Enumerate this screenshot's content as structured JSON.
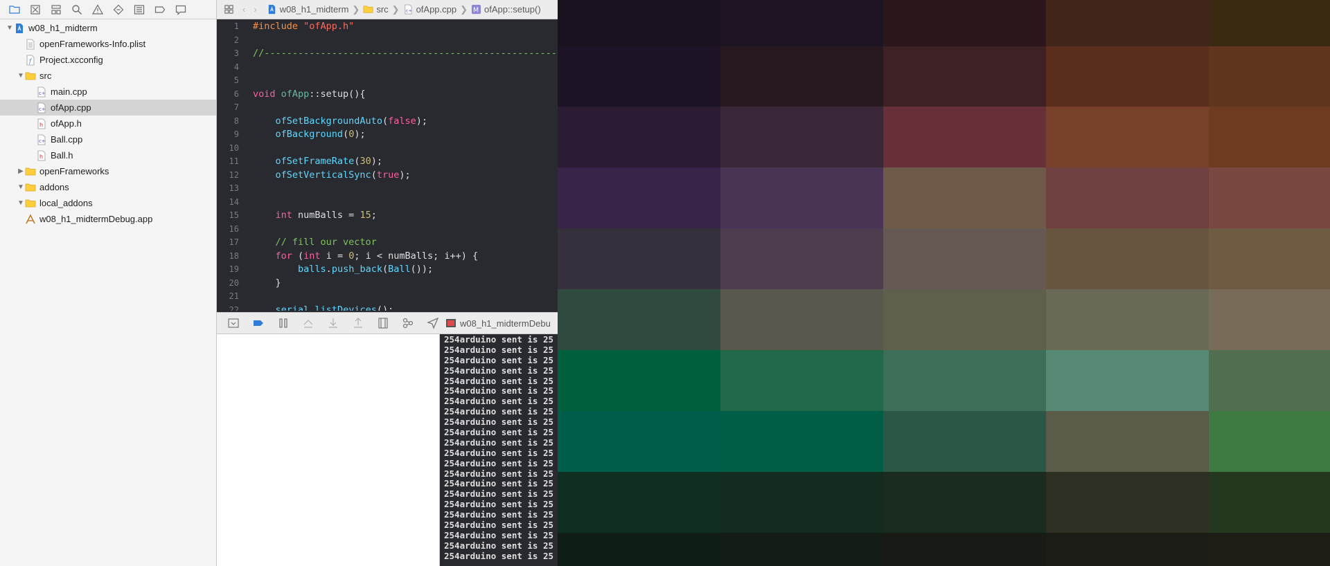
{
  "navigator": {
    "toolbar_icons": [
      "folder-icon",
      "source-control-icon",
      "symbol-icon",
      "find-icon",
      "issue-icon",
      "test-icon",
      "debug-icon",
      "breakpoint-icon",
      "report-icon"
    ],
    "items": [
      {
        "label": "w08_h1_midterm",
        "type": "project",
        "indent": 0,
        "disclosure": "open",
        "selected": false
      },
      {
        "label": "openFrameworks-Info.plist",
        "type": "plist",
        "indent": 1,
        "disclosure": "",
        "selected": false
      },
      {
        "label": "Project.xcconfig",
        "type": "config",
        "indent": 1,
        "disclosure": "",
        "selected": false
      },
      {
        "label": "src",
        "type": "folder",
        "indent": 1,
        "disclosure": "open",
        "selected": false
      },
      {
        "label": "main.cpp",
        "type": "cpp",
        "indent": 2,
        "disclosure": "",
        "selected": false
      },
      {
        "label": "ofApp.cpp",
        "type": "cpp",
        "indent": 2,
        "disclosure": "",
        "selected": true
      },
      {
        "label": "ofApp.h",
        "type": "header",
        "indent": 2,
        "disclosure": "",
        "selected": false
      },
      {
        "label": "Ball.cpp",
        "type": "cpp",
        "indent": 2,
        "disclosure": "",
        "selected": false
      },
      {
        "label": "Ball.h",
        "type": "header",
        "indent": 2,
        "disclosure": "",
        "selected": false
      },
      {
        "label": "openFrameworks",
        "type": "folder",
        "indent": 1,
        "disclosure": "closed",
        "selected": false
      },
      {
        "label": "addons",
        "type": "folder",
        "indent": 1,
        "disclosure": "open",
        "selected": false
      },
      {
        "label": "local_addons",
        "type": "folder",
        "indent": 1,
        "disclosure": "open",
        "selected": false
      },
      {
        "label": "w08_h1_midtermDebug.app",
        "type": "app",
        "indent": 1,
        "disclosure": "",
        "selected": false
      }
    ]
  },
  "jumpbar": {
    "crumbs": [
      {
        "label": "w08_h1_midterm",
        "icon": "project-icon"
      },
      {
        "label": "src",
        "icon": "folder-icon"
      },
      {
        "label": "ofApp.cpp",
        "icon": "cpp-file-icon"
      },
      {
        "label": "ofApp::setup()",
        "icon": "method-icon"
      }
    ]
  },
  "editor": {
    "lines": [
      {
        "n": "1",
        "t": [
          [
            "pp",
            "#include "
          ],
          [
            "str",
            "\"ofApp.h\""
          ]
        ]
      },
      {
        "n": "2",
        "t": []
      },
      {
        "n": "3",
        "t": [
          [
            "cmg",
            "//--------------------------------------------------------------"
          ]
        ]
      },
      {
        "n": "4",
        "t": []
      },
      {
        "n": "5",
        "t": []
      },
      {
        "n": "6",
        "t": [
          [
            "kw",
            "void "
          ],
          [
            "cls",
            "ofApp"
          ],
          [
            "src",
            "::setup(){"
          ]
        ]
      },
      {
        "n": "7",
        "t": []
      },
      {
        "n": "8",
        "t": [
          [
            "src",
            "    "
          ],
          [
            "fn",
            "ofSetBackgroundAuto"
          ],
          [
            "src",
            "("
          ],
          [
            "kw",
            "false"
          ],
          [
            "src",
            ");"
          ]
        ]
      },
      {
        "n": "9",
        "t": [
          [
            "src",
            "    "
          ],
          [
            "fn",
            "ofBackground"
          ],
          [
            "src",
            "("
          ],
          [
            "num",
            "0"
          ],
          [
            "src",
            ");"
          ]
        ]
      },
      {
        "n": "10",
        "t": []
      },
      {
        "n": "11",
        "t": [
          [
            "src",
            "    "
          ],
          [
            "fn",
            "ofSetFrameRate"
          ],
          [
            "src",
            "("
          ],
          [
            "num",
            "30"
          ],
          [
            "src",
            ");"
          ]
        ]
      },
      {
        "n": "12",
        "t": [
          [
            "src",
            "    "
          ],
          [
            "fn",
            "ofSetVerticalSync"
          ],
          [
            "src",
            "("
          ],
          [
            "kw",
            "true"
          ],
          [
            "src",
            ");"
          ]
        ]
      },
      {
        "n": "13",
        "t": []
      },
      {
        "n": "14",
        "t": []
      },
      {
        "n": "15",
        "t": [
          [
            "src",
            "    "
          ],
          [
            "kw",
            "int "
          ],
          [
            "src",
            "numBalls = "
          ],
          [
            "num",
            "15"
          ],
          [
            "src",
            ";"
          ]
        ]
      },
      {
        "n": "16",
        "t": []
      },
      {
        "n": "17",
        "t": [
          [
            "src",
            "    "
          ],
          [
            "cmg",
            "// fill our vector"
          ]
        ]
      },
      {
        "n": "18",
        "t": [
          [
            "src",
            "    "
          ],
          [
            "kw",
            "for "
          ],
          [
            "src",
            "("
          ],
          [
            "kw",
            "int "
          ],
          [
            "src",
            "i = "
          ],
          [
            "num",
            "0"
          ],
          [
            "src",
            "; i < numBalls; i++) {"
          ]
        ]
      },
      {
        "n": "19",
        "t": [
          [
            "src",
            "        "
          ],
          [
            "fn",
            "balls"
          ],
          [
            "src",
            "."
          ],
          [
            "fn",
            "push_back"
          ],
          [
            "src",
            "("
          ],
          [
            "fn",
            "Ball"
          ],
          [
            "src",
            "());"
          ]
        ]
      },
      {
        "n": "20",
        "t": [
          [
            "src",
            "    }"
          ]
        ]
      },
      {
        "n": "21",
        "t": []
      },
      {
        "n": "22",
        "t": [
          [
            "src",
            "    "
          ],
          [
            "fn",
            "serial"
          ],
          [
            "src",
            "."
          ],
          [
            "fn",
            "listDevices"
          ],
          [
            "src",
            "();"
          ]
        ]
      }
    ]
  },
  "debug": {
    "target_label": "w08_h1_midtermDebu",
    "icons": [
      "hide-debug-area-icon",
      "breakpoints-icon",
      "pause-icon",
      "step-over-icon",
      "step-into-icon",
      "step-out-icon",
      "view-debugger-icon",
      "memory-graph-icon",
      "location-icon"
    ]
  },
  "console": {
    "line_text": "254arduino sent is 25",
    "line_count": 22
  },
  "app_window": {
    "colors": [
      [
        "#1b1220",
        "#1f1424",
        "#2b171b",
        "#41241a",
        "#3b2a12",
        "#3b1e12"
      ],
      [
        "#1d1326",
        "#28181f",
        "#3e2124",
        "#5a2d1d",
        "#62351e",
        "#55260f"
      ],
      [
        "#2b1b33",
        "#3a2838",
        "#672f37",
        "#77402a",
        "#6d3b20",
        "#5f2c18"
      ],
      [
        "#382449",
        "#4a3455",
        "#6f5a4a",
        "#703f40",
        "#794840",
        "#7b4c45"
      ],
      [
        "#36303c",
        "#4d3d4f",
        "#665853",
        "#67553f",
        "#6f5b42",
        "#835635"
      ],
      [
        "#2f4a3f",
        "#5a574c",
        "#5f5f4b",
        "#6a6957",
        "#786c58",
        "#74674f"
      ],
      [
        "#005f3c",
        "#22684b",
        "#3d6e57",
        "#578a74",
        "#516e51",
        "#4c6d4a"
      ],
      [
        "#005f4a",
        "#005e46",
        "#2c5646",
        "#5a5c49",
        "#3d7b42",
        "#3d7b42"
      ],
      [
        "#102f21",
        "#142b1f",
        "#1a2b1f",
        "#2c2f22",
        "#24381f",
        "#24381f"
      ],
      [
        "#0e1e15",
        "#131c15",
        "#181b15",
        "#1c1c16",
        "#1e1d16",
        "#1e1d16"
      ]
    ]
  }
}
